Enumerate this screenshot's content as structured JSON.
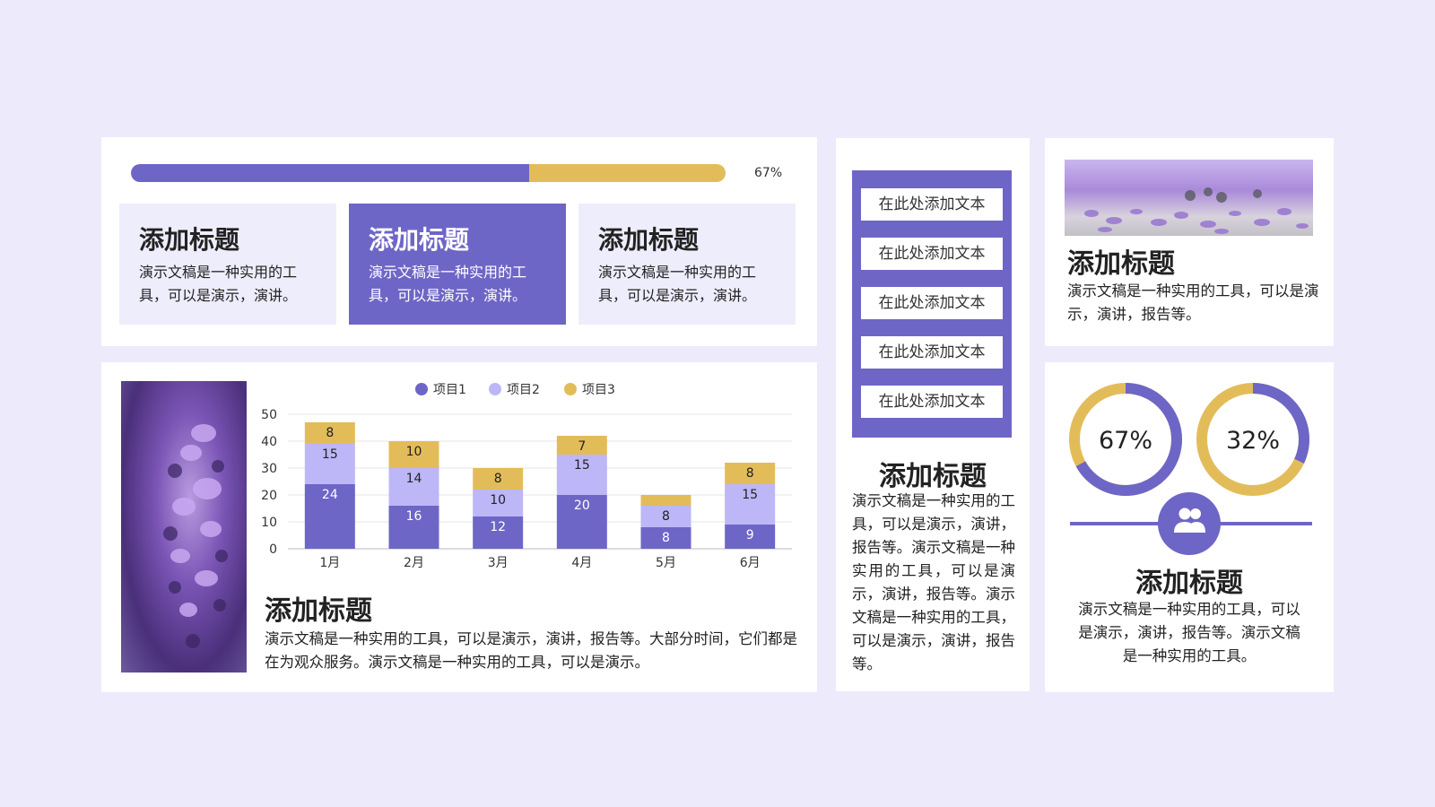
{
  "colors": {
    "background": "#eceafb",
    "purple": "#6e66c6",
    "lavender": "#bdb7f7",
    "gold": "#e3bc5a",
    "light_card": "#eeedfc",
    "white": "#ffffff"
  },
  "progress": {
    "value": 67,
    "label": "67%"
  },
  "cards": [
    {
      "title": "添加标题",
      "text": "演示文稿是一种实用的工具，可以是演示，演讲。"
    },
    {
      "title": "添加标题",
      "text": "演示文稿是一种实用的工具，可以是演示，演讲。"
    },
    {
      "title": "添加标题",
      "text": "演示文稿是一种实用的工具，可以是演示，演讲。"
    }
  ],
  "chart_panel": {
    "title": "添加标题",
    "text": "演示文稿是一种实用的工具，可以是演示，演讲，报告等。大部分时间，它们都是在为观众服务。演示文稿是一种实用的工具，可以是演示。"
  },
  "chart_data": {
    "type": "bar",
    "stacked": true,
    "categories": [
      "1月",
      "2月",
      "3月",
      "4月",
      "5月",
      "6月"
    ],
    "series": [
      {
        "name": "项目1",
        "color": "#6e66c6",
        "values": [
          24,
          16,
          12,
          20,
          8,
          9
        ]
      },
      {
        "name": "项目2",
        "color": "#bdb7f7",
        "values": [
          15,
          14,
          10,
          15,
          8,
          15
        ]
      },
      {
        "name": "项目3",
        "color": "#e3bc5a",
        "values": [
          8,
          10,
          8,
          7,
          4,
          8
        ]
      }
    ],
    "value_labels_hidden": [
      [
        false,
        false,
        false,
        false,
        false,
        false
      ],
      [
        false,
        false,
        false,
        false,
        false,
        false
      ],
      [
        false,
        false,
        false,
        false,
        true,
        false
      ]
    ],
    "yticks": [
      0,
      10,
      20,
      30,
      40,
      50
    ],
    "ylim": [
      0,
      50
    ],
    "legend_position": "top",
    "grid": true
  },
  "list_panel": {
    "items": [
      "在此处添加文本",
      "在此处添加文本",
      "在此处添加文本",
      "在此处添加文本",
      "在此处添加文本"
    ],
    "title": "添加标题",
    "text": "演示文稿是一种实用的工具，可以是演示，演讲，报告等。演示文稿是一种实用的工具，可以是演示，演讲，报告等。演示文稿是一种实用的工具，可以是演示，演讲，报告等。"
  },
  "photo_panel": {
    "title": "添加标题",
    "text": "演示文稿是一种实用的工具，可以是演示，演讲，报告等。"
  },
  "donut_panel": {
    "donuts": [
      {
        "value": 67,
        "label": "67%"
      },
      {
        "value": 32,
        "label": "32%"
      }
    ],
    "icon": "users-icon",
    "title": "添加标题",
    "text": "演示文稿是一种实用的工具，可以是演示，演讲，报告等。演示文稿是一种实用的工具。"
  }
}
